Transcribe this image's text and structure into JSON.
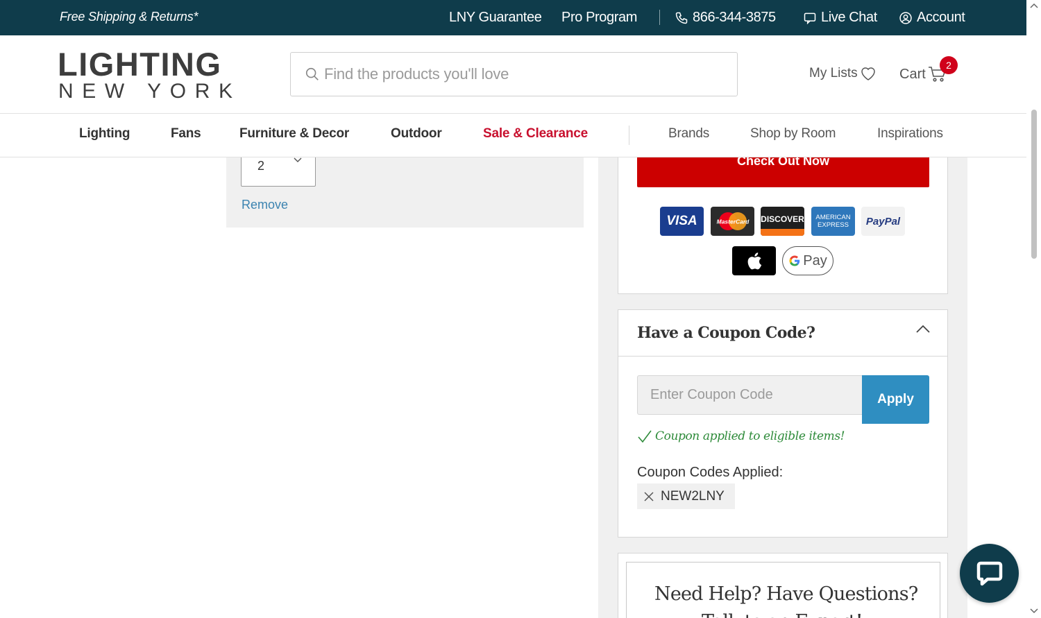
{
  "topbar": {
    "promo": "Free Shipping & Returns*",
    "guarantee": "LNY Guarantee",
    "pro_program": "Pro Program",
    "phone": "866-344-3875",
    "live_chat": "Live Chat",
    "account": "Account",
    "bg_color": "#0f3c4b"
  },
  "header": {
    "logo_top": "LIGHTING",
    "logo_bottom": "NEW YORK",
    "search_placeholder": "Find the products you'll love",
    "my_lists": "My Lists",
    "cart": "Cart",
    "cart_count": "2"
  },
  "nav": {
    "items": [
      "Lighting",
      "Fans",
      "Furniture & Decor",
      "Outdoor",
      "Sale & Clearance",
      "Brands",
      "Shop by Room",
      "Inspirations"
    ]
  },
  "cart_item": {
    "quantity": "2",
    "remove_label": "Remove"
  },
  "checkout": {
    "button_label": "Check Out Now",
    "payment_methods": [
      "VISA",
      "MasterCard",
      "DISCOVER",
      "AMERICAN EXPRESS",
      "PayPal",
      "Apple Pay",
      "G Pay"
    ],
    "payment_labels": {
      "visa": "VISA",
      "mastercard": "MasterCard",
      "discover": "DISCOVER",
      "amex_top": "AMERICAN",
      "amex_bottom": "EXPRESS",
      "paypal": "PayPal",
      "gpay": "Pay"
    }
  },
  "coupon": {
    "title": "Have a Coupon Code?",
    "input_placeholder": "Enter Coupon Code",
    "apply_label": "Apply",
    "success_message": "Coupon applied to eligible items!",
    "applied_label": "Coupon Codes Applied:",
    "applied_codes": [
      "NEW2LNY"
    ]
  },
  "help": {
    "title": "Need Help? Have Questions?",
    "subtitle": "Talk to an Expert!"
  },
  "colors": {
    "accent_red": "#cc0000",
    "sale_red": "#c8102e",
    "apply_blue": "#2f8ec1",
    "link_blue": "#3b83b0",
    "success_green": "#2e8b3a"
  }
}
